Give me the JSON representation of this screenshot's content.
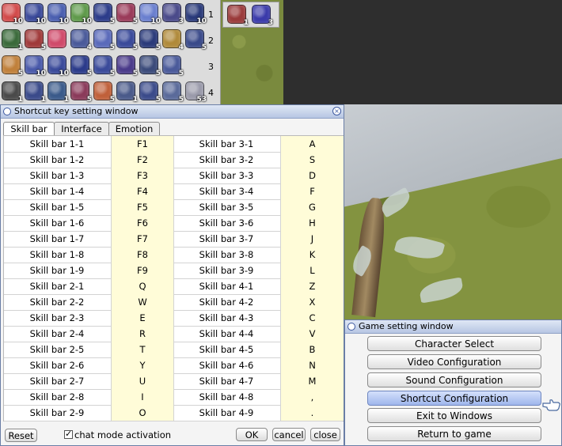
{
  "hotbar": {
    "rows": [
      {
        "num": "1",
        "slots": [
          {
            "icon": "heal-icon",
            "color": "#d24b4b",
            "count": "10"
          },
          {
            "icon": "spiral-icon",
            "color": "#3b4a9a",
            "count": "10"
          },
          {
            "icon": "sparkle-icon",
            "color": "#4b5fb0",
            "count": "10"
          },
          {
            "icon": "bell-icon",
            "color": "#5f9a4b",
            "count": "10"
          },
          {
            "icon": "star-icon",
            "color": "#2c3c8a",
            "count": "5"
          },
          {
            "icon": "shield-icon",
            "color": "#9a3b5a",
            "count": "5"
          },
          {
            "icon": "orb-icon",
            "color": "#6a7fcf",
            "count": "10"
          },
          {
            "icon": "wing-icon",
            "color": "#4a4a8a",
            "count": "3"
          },
          {
            "icon": "rune-icon",
            "color": "#2a3a7a",
            "count": "10"
          }
        ]
      },
      {
        "num": "2",
        "slots": [
          {
            "icon": "cross-icon",
            "color": "#3a6a3a",
            "count": "1"
          },
          {
            "icon": "gear-icon",
            "color": "#a03a3a",
            "count": "5"
          },
          {
            "icon": "heart-icon",
            "color": "#d04a6a",
            "count": ""
          },
          {
            "icon": "book-icon",
            "color": "#4a5a9a",
            "count": "4"
          },
          {
            "icon": "swirl-icon",
            "color": "#5a6aba",
            "count": "5"
          },
          {
            "icon": "crystal-icon",
            "color": "#3a4a9a",
            "count": "5"
          },
          {
            "icon": "sword-icon",
            "color": "#2a3a7a",
            "count": "5"
          },
          {
            "icon": "scroll-icon",
            "color": "#b08a3a",
            "count": "4"
          },
          {
            "icon": "staff-icon",
            "color": "#3a4a8a",
            "count": "5"
          }
        ]
      },
      {
        "num": "3",
        "slots": [
          {
            "icon": "fist-icon",
            "color": "#c0803a",
            "count": "5"
          },
          {
            "icon": "pillar-icon",
            "color": "#4a5aaa",
            "count": "10"
          },
          {
            "icon": "wave-icon",
            "color": "#3a4a9a",
            "count": "10"
          },
          {
            "icon": "bolt-icon",
            "color": "#2a3a8a",
            "count": "5"
          },
          {
            "icon": "flare-icon",
            "color": "#3a4a9a",
            "count": "5"
          },
          {
            "icon": "aura-icon",
            "color": "#4a3a8a",
            "count": "5"
          },
          {
            "icon": "target-icon",
            "color": "#3a4a7a",
            "count": "5"
          },
          {
            "icon": "halo-icon",
            "color": "#4a5a9a",
            "count": "5"
          }
        ]
      },
      {
        "num": "4",
        "slots": [
          {
            "icon": "mask-icon",
            "color": "#4a4a4a",
            "count": "1"
          },
          {
            "icon": "figure-icon",
            "color": "#3a4a8a",
            "count": "1"
          },
          {
            "icon": "totem-icon",
            "color": "#3a5a8a",
            "count": "1"
          },
          {
            "icon": "burst-icon",
            "color": "#8a3a5a",
            "count": "5"
          },
          {
            "icon": "cancel-icon",
            "color": "#c0603a",
            "count": "5"
          },
          {
            "icon": "ghost-icon",
            "color": "#4a5a8a",
            "count": "1"
          },
          {
            "icon": "idol-icon",
            "color": "#3a4a8a",
            "count": "5"
          },
          {
            "icon": "spirit-icon",
            "color": "#5a6a9a",
            "count": "5"
          },
          {
            "icon": "potion-icon",
            "color": "#9a9aaa",
            "count": "53"
          }
        ]
      }
    ],
    "extra": [
      {
        "icon": "stance-icon",
        "color": "#9a3a3a",
        "count": "1"
      },
      {
        "icon": "vortex-icon",
        "color": "#3a3aaa",
        "count": "3"
      }
    ]
  },
  "shortcut_window": {
    "title": "Shortcut key setting window",
    "close_glyph": "×",
    "tabs": [
      "Skill bar",
      "Interface",
      "Emotion"
    ],
    "rows": [
      [
        "Skill bar 1-1",
        "F1",
        "Skill bar 3-1",
        "A"
      ],
      [
        "Skill bar 1-2",
        "F2",
        "Skill bar 3-2",
        "S"
      ],
      [
        "Skill bar 1-3",
        "F3",
        "Skill bar 3-3",
        "D"
      ],
      [
        "Skill bar 1-4",
        "F4",
        "Skill bar 3-4",
        "F"
      ],
      [
        "Skill bar 1-5",
        "F5",
        "Skill bar 3-5",
        "G"
      ],
      [
        "Skill bar 1-6",
        "F6",
        "Skill bar 3-6",
        "H"
      ],
      [
        "Skill bar 1-7",
        "F7",
        "Skill bar 3-7",
        "J"
      ],
      [
        "Skill bar 1-8",
        "F8",
        "Skill bar 3-8",
        "K"
      ],
      [
        "Skill bar 1-9",
        "F9",
        "Skill bar 3-9",
        "L"
      ],
      [
        "Skill bar 2-1",
        "Q",
        "Skill bar 4-1",
        "Z"
      ],
      [
        "Skill bar 2-2",
        "W",
        "Skill bar 4-2",
        "X"
      ],
      [
        "Skill bar 2-3",
        "E",
        "Skill bar 4-3",
        "C"
      ],
      [
        "Skill bar 2-4",
        "R",
        "Skill bar 4-4",
        "V"
      ],
      [
        "Skill bar 2-5",
        "T",
        "Skill bar 4-5",
        "B"
      ],
      [
        "Skill bar 2-6",
        "Y",
        "Skill bar 4-6",
        "N"
      ],
      [
        "Skill bar 2-7",
        "U",
        "Skill bar 4-7",
        "M"
      ],
      [
        "Skill bar 2-8",
        "I",
        "Skill bar 4-8",
        ","
      ],
      [
        "Skill bar 2-9",
        "O",
        "Skill bar 4-9",
        "."
      ]
    ],
    "reset_label": "Reset",
    "chat_mode_label": "chat mode activation",
    "ok_label": "OK",
    "cancel_label": "cancel",
    "close_label": "close"
  },
  "game_window": {
    "title": "Game setting window",
    "buttons": [
      "Character Select",
      "Video Configuration",
      "Sound Configuration",
      "Shortcut Configuration",
      "Exit to Windows",
      "Return to game"
    ],
    "highlighted_index": 3
  }
}
